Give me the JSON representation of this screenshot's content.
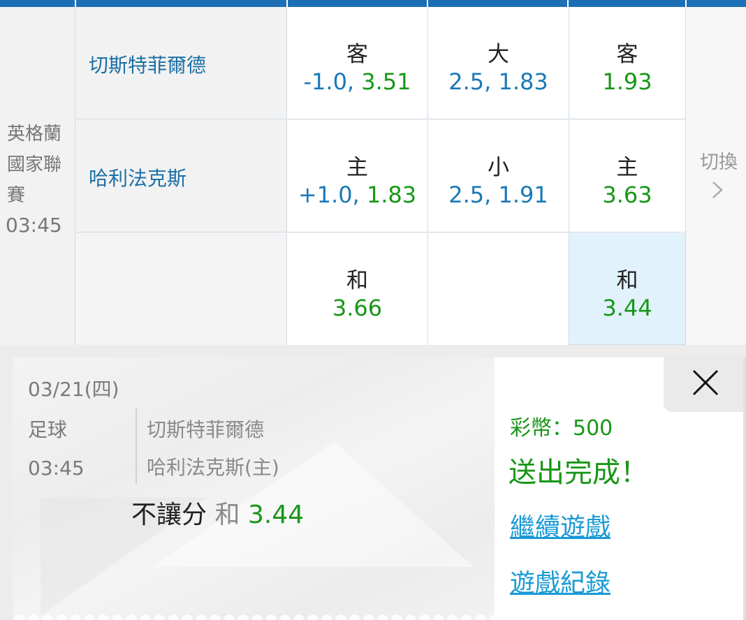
{
  "league": {
    "name": "英格蘭國家聯賽",
    "time": "03:45"
  },
  "teams": {
    "away": "切斯特菲爾德",
    "home": "哈利法克斯"
  },
  "odds": {
    "handicap_away": {
      "label": "客",
      "line": "-1.0,",
      "price": "3.51"
    },
    "handicap_home": {
      "label": "主",
      "line": "+1.0,",
      "price": "1.83"
    },
    "handicap_draw": {
      "label": "和",
      "price": "3.66"
    },
    "total_over": {
      "label": "大",
      "value": "2.5, 1.83"
    },
    "total_under": {
      "label": "小",
      "value": "2.5, 1.91"
    },
    "moneyline_away": {
      "label": "客",
      "price": "1.93"
    },
    "moneyline_home": {
      "label": "主",
      "price": "3.63"
    },
    "moneyline_draw": {
      "label": "和",
      "price": "3.44"
    }
  },
  "switch": {
    "label": "切換",
    "chevron": "chevron-right-icon"
  },
  "slip": {
    "date": "03/21(四)",
    "sport": "足球",
    "time": "03:45",
    "away": "切斯特菲爾德",
    "home": "哈利法克斯(主)",
    "bet_type": "不讓分",
    "selection": "和",
    "odds": "3.44"
  },
  "result": {
    "coins": "彩幣：500",
    "status": "送出完成！",
    "continue_link": "繼續遊戲",
    "history_link": "遊戲紀錄"
  },
  "colors": {
    "blue": "#1a78b8",
    "green": "#179617",
    "link": "#1a9ad6",
    "selected": "#e2f2fc",
    "topbar": "#1c6fb4"
  }
}
